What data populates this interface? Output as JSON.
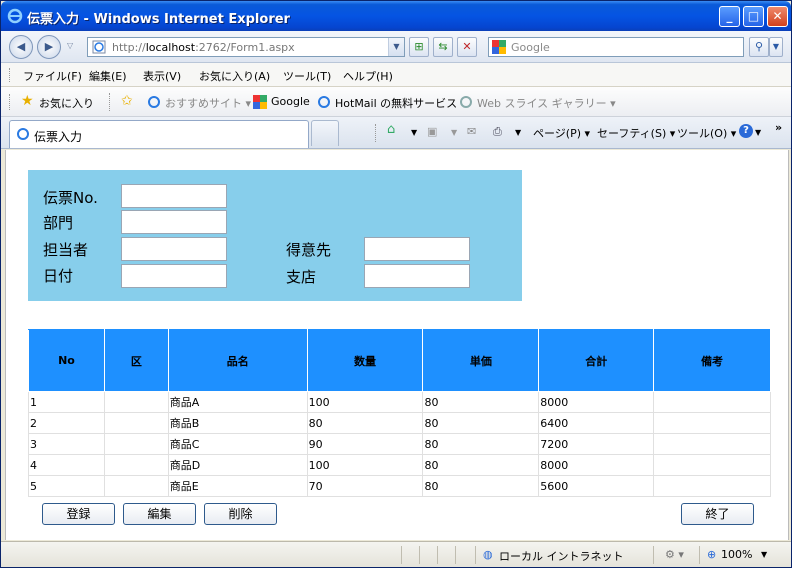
{
  "window": {
    "title": "伝票入力 - Windows Internet Explorer"
  },
  "address": {
    "url_prefix": "http://",
    "url_host": "localhost",
    "url_rest": ":2762/Form1.aspx",
    "search_placeholder": "Google"
  },
  "menu": {
    "items": [
      "ファイル(F)",
      "編集(E)",
      "表示(V)",
      "お気に入り(A)",
      "ツール(T)",
      "ヘルプ(H)"
    ]
  },
  "favorites": {
    "favorites_label": "お気に入り",
    "suggested_sites": "おすすめサイト ▾",
    "google": "Google",
    "hotmail": "HotMail の無料サービス",
    "web_slice": "Web スライス ギャラリー ▾"
  },
  "tabbar": {
    "tab_label": "伝票入力",
    "page_menu": "ページ(P) ▾",
    "safety_menu": "セーフティ(S) ▾",
    "tools_menu": "ツール(O) ▾"
  },
  "form": {
    "voucher_no_label": "伝票No.",
    "department_label": "部門",
    "staff_label": "担当者",
    "date_label": "日付",
    "customer_label": "得意先",
    "branch_label": "支店",
    "voucher_no": "",
    "department": "",
    "staff": "",
    "date": "",
    "customer": "",
    "branch": ""
  },
  "grid": {
    "headers": [
      "No",
      "区",
      "品名",
      "数量",
      "単価",
      "合計",
      "備考"
    ],
    "rows": [
      [
        "1",
        "",
        "商品A",
        "100",
        "80",
        "8000",
        ""
      ],
      [
        "2",
        "",
        "商品B",
        "80",
        "80",
        "6400",
        ""
      ],
      [
        "3",
        "",
        "商品C",
        "90",
        "80",
        "7200",
        ""
      ],
      [
        "4",
        "",
        "商品D",
        "100",
        "80",
        "8000",
        ""
      ],
      [
        "5",
        "",
        "商品E",
        "70",
        "80",
        "5600",
        ""
      ]
    ]
  },
  "buttons": {
    "register": "登録",
    "edit": "編集",
    "delete": "削除",
    "exit": "終了"
  },
  "status": {
    "zone": "ローカル イントラネット",
    "zoom": "100%"
  },
  "colors": {
    "form_panel": "#87ceeb",
    "grid_header": "#1e90ff",
    "titlebar": "#0554e3"
  }
}
